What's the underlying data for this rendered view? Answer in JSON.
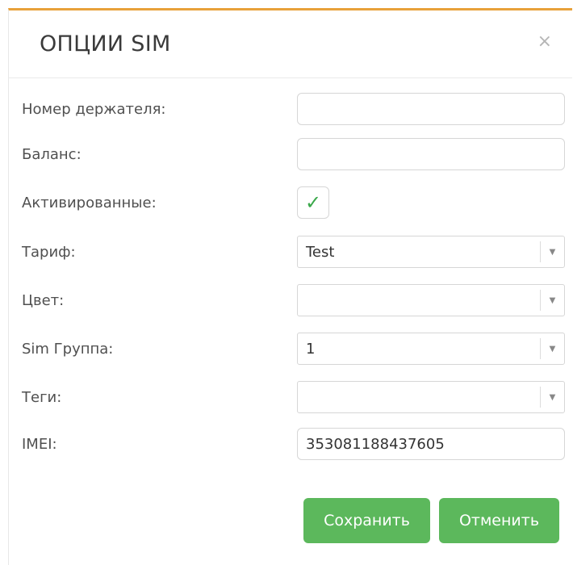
{
  "dialog": {
    "title": "ОПЦИИ SIM",
    "close_icon": "×"
  },
  "fields": {
    "holder_number": {
      "label": "Номер держателя:",
      "value": ""
    },
    "balance": {
      "label": "Баланс:",
      "value": ""
    },
    "activated": {
      "label": "Активированные:",
      "checked": true,
      "check_glyph": "✓"
    },
    "tariff": {
      "label": "Тариф:",
      "value": "Test"
    },
    "color": {
      "label": "Цвет:",
      "value": ""
    },
    "sim_group": {
      "label": "Sim Группа:",
      "value": "1"
    },
    "tags": {
      "label": "Теги:",
      "value": ""
    },
    "imei": {
      "label": "IMEI:",
      "value": "353081188437605"
    }
  },
  "icons": {
    "dropdown_arrow": "▼"
  },
  "buttons": {
    "save": "Сохранить",
    "cancel": "Отменить"
  },
  "colors": {
    "accent_border": "#e8a13a",
    "button_green": "#5cb85c",
    "check_green": "#3aa84a"
  }
}
